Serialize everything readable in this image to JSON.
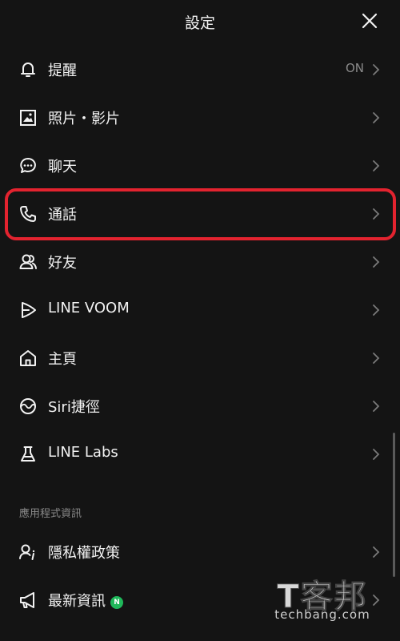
{
  "header": {
    "title": "設定",
    "close_icon": "close-icon"
  },
  "items": [
    {
      "id": "notifications",
      "label": "提醒",
      "icon": "bell-icon",
      "value": "ON"
    },
    {
      "id": "photos-videos",
      "label": "照片・影片",
      "icon": "photo-icon"
    },
    {
      "id": "chats",
      "label": "聊天",
      "icon": "chat-bubble-icon"
    },
    {
      "id": "calls",
      "label": "通話",
      "icon": "phone-icon",
      "highlighted": true
    },
    {
      "id": "friends",
      "label": "好友",
      "icon": "friends-icon"
    },
    {
      "id": "line-voom",
      "label": "LINE VOOM",
      "icon": "play-icon"
    },
    {
      "id": "home",
      "label": "主頁",
      "icon": "home-icon"
    },
    {
      "id": "siri-shortcuts",
      "label": "Siri捷徑",
      "icon": "siri-icon"
    },
    {
      "id": "line-labs",
      "label": "LINE Labs",
      "icon": "flask-icon"
    }
  ],
  "app_info": {
    "section_title": "應用程式資訊",
    "items": [
      {
        "id": "privacy-policy",
        "label": "隱私權政策",
        "icon": "privacy-person-icon"
      },
      {
        "id": "news",
        "label": "最新資訊",
        "icon": "megaphone-icon",
        "badge": "N"
      }
    ]
  },
  "watermark": {
    "big": "T客邦",
    "small": "techbang.com"
  },
  "colors": {
    "background": "#141414",
    "highlight": "#e3232f",
    "badge": "#1fb85a",
    "muted": "#8a8a8a"
  }
}
